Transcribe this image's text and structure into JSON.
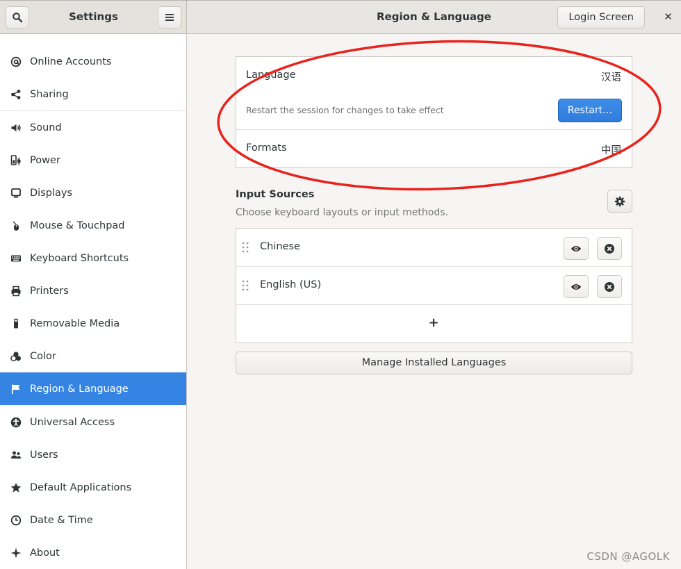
{
  "header": {
    "sidebar_title": "Settings",
    "page_title": "Region & Language",
    "login_button": "Login Screen",
    "close_glyph": "✕"
  },
  "sidebar": {
    "items": [
      {
        "label": "Online Accounts",
        "icon": "at-icon"
      },
      {
        "label": "Sharing",
        "icon": "share-icon"
      },
      {
        "label": "Sound",
        "icon": "speaker-icon"
      },
      {
        "label": "Power",
        "icon": "power-plug-icon"
      },
      {
        "label": "Displays",
        "icon": "monitor-icon"
      },
      {
        "label": "Mouse & Touchpad",
        "icon": "mouse-icon"
      },
      {
        "label": "Keyboard Shortcuts",
        "icon": "keyboard-icon"
      },
      {
        "label": "Printers",
        "icon": "printer-icon"
      },
      {
        "label": "Removable Media",
        "icon": "usb-icon"
      },
      {
        "label": "Color",
        "icon": "color-icon"
      },
      {
        "label": "Region & Language",
        "icon": "flag-icon",
        "selected": true
      },
      {
        "label": "Universal Access",
        "icon": "accessibility-icon"
      },
      {
        "label": "Users",
        "icon": "users-icon"
      },
      {
        "label": "Default Applications",
        "icon": "star-icon"
      },
      {
        "label": "Date & Time",
        "icon": "clock-icon"
      },
      {
        "label": "About",
        "icon": "sparkle-icon"
      }
    ]
  },
  "language_section": {
    "language_label": "Language",
    "language_value": "汉语",
    "restart_hint": "Restart the session for changes to take effect",
    "restart_button": "Restart…",
    "formats_label": "Formats",
    "formats_value": "中国"
  },
  "input_sources": {
    "title": "Input Sources",
    "subtitle": "Choose keyboard layouts or input methods.",
    "sources": [
      {
        "name": "Chinese"
      },
      {
        "name": "English (US)"
      }
    ],
    "add_glyph": "+"
  },
  "manage_button": "Manage Installed Languages",
  "watermark": "CSDN @AGOLK",
  "colors": {
    "accent": "#3584e4",
    "annotation": "#e8231c"
  }
}
